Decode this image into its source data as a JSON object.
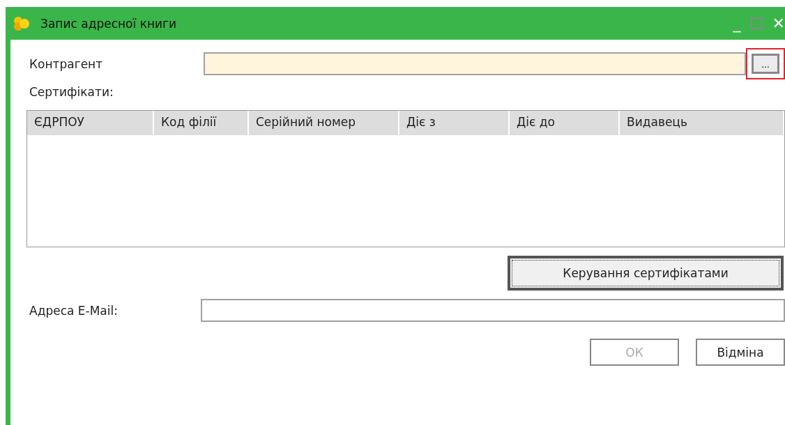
{
  "window": {
    "title": "Запис адресної книги",
    "minimize": "_",
    "close": "✕"
  },
  "contractor": {
    "label": "Контрагент",
    "browse_button": {
      "label": "...",
      "highlighted": true
    }
  },
  "certificates": {
    "label": "Сертифікати:",
    "columns": [
      "ЄДРПОУ",
      "Код філії",
      "Серійний номер",
      "Діє з",
      "Діє до",
      "Видавець"
    ],
    "manage_button": {
      "label": "Керування сертифікатами",
      "focused": true
    }
  },
  "email": {
    "label": "Адреса E-Mail:"
  },
  "buttons": [
    {
      "label": "ОК",
      "disabled": true
    },
    {
      "label": "Відміна",
      "disabled": false
    }
  ]
}
